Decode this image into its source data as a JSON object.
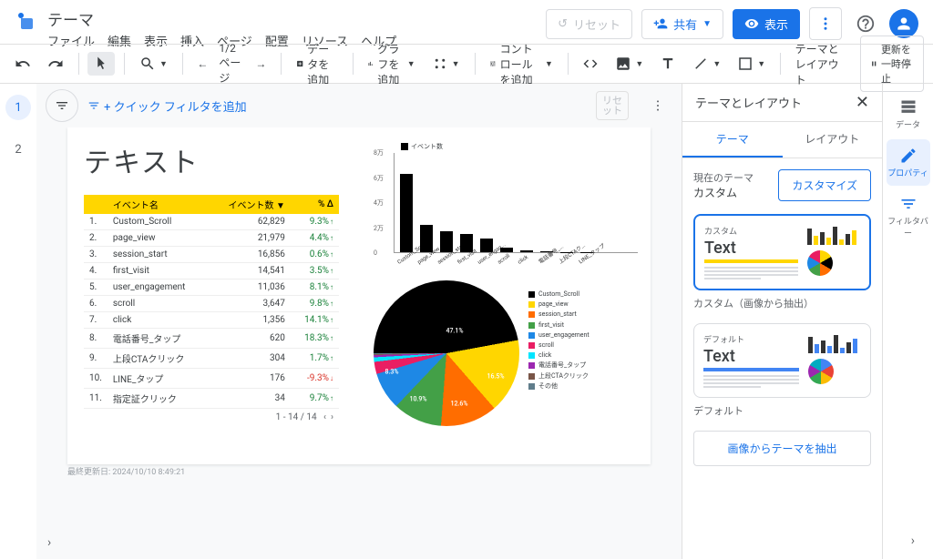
{
  "doc_title": "テーマ",
  "menu": [
    "ファイル",
    "編集",
    "表示",
    "挿入",
    "ページ",
    "配置",
    "リソース",
    "ヘルプ"
  ],
  "actions": {
    "reset": "リセット",
    "share": "共有",
    "view": "表示"
  },
  "tool_texts": {
    "page": "1/2 ページ",
    "add_data": "データを追加",
    "add_chart": "グラフを追加",
    "add_control": "コントロールを追加",
    "theme_layout": "テーマとレイアウト",
    "pause": "更新を一時停止"
  },
  "filter": {
    "quick": "+ クイック フィルタを追加",
    "reset": "リセット"
  },
  "report": {
    "title": "テキスト",
    "table_headers": [
      "イベント名",
      "イベント数",
      "% Δ"
    ],
    "rows": [
      {
        "n": 1,
        "name": "Custom_Scroll",
        "count": "62,829",
        "delta": "9.3%",
        "up": true
      },
      {
        "n": 2,
        "name": "page_view",
        "count": "21,979",
        "delta": "4.4%",
        "up": true
      },
      {
        "n": 3,
        "name": "session_start",
        "count": "16,856",
        "delta": "0.6%",
        "up": true
      },
      {
        "n": 4,
        "name": "first_visit",
        "count": "14,541",
        "delta": "3.5%",
        "up": true
      },
      {
        "n": 5,
        "name": "user_engagement",
        "count": "11,036",
        "delta": "8.1%",
        "up": true
      },
      {
        "n": 6,
        "name": "scroll",
        "count": "3,647",
        "delta": "9.8%",
        "up": true
      },
      {
        "n": 7,
        "name": "click",
        "count": "1,356",
        "delta": "14.1%",
        "up": true
      },
      {
        "n": 8,
        "name": "電話番号_タップ",
        "count": "620",
        "delta": "18.3%",
        "up": true
      },
      {
        "n": 9,
        "name": "上段CTAクリック",
        "count": "304",
        "delta": "1.7%",
        "up": true
      },
      {
        "n": 10,
        "name": "LINE_タップ",
        "count": "176",
        "delta": "-9.3%",
        "up": false
      },
      {
        "n": 11,
        "name": "指定証クリック",
        "count": "34",
        "delta": "9.7%",
        "up": true
      }
    ],
    "pager": "1 - 14 / 14",
    "timestamp": "最終更新日: 2024/10/10 8:49:21"
  },
  "chart_data": {
    "bar": {
      "type": "bar",
      "legend": "イベント数",
      "ylim": [
        0,
        80000
      ],
      "yticks": [
        "0",
        "2万",
        "4万",
        "6万",
        "8万"
      ],
      "categories": [
        "Custom_Sc...",
        "page_view",
        "session_sta...",
        "first_visit",
        "user_engag...",
        "scroll",
        "click",
        "電話番号_...",
        "上段CTAク...",
        "LINE_タップ"
      ],
      "values": [
        62829,
        21979,
        16856,
        14541,
        11036,
        3647,
        1356,
        620,
        304,
        176
      ]
    },
    "pie": {
      "type": "pie",
      "labels": [
        "Custom_Scroll",
        "page_view",
        "session_start",
        "first_visit",
        "user_engagement",
        "scroll",
        "click",
        "電話番号_タップ",
        "上段CTAクリック",
        "その他"
      ],
      "values": [
        47.1,
        16.5,
        12.6,
        10.9,
        8.3,
        2.7,
        1.0,
        0.5,
        0.2,
        0.2
      ],
      "shown_labels": [
        "47.1%",
        "16.5%",
        "12.6%",
        "10.9%",
        "8.3%"
      ],
      "colors": [
        "#000000",
        "#ffd600",
        "#ff6d00",
        "#43a047",
        "#1e88e5",
        "#e91e63",
        "#00e5ff",
        "#9c27b0",
        "#795548",
        "#607d8b"
      ]
    }
  },
  "panel": {
    "title": "テーマとレイアウト",
    "tabs": [
      "テーマ",
      "レイアウト"
    ],
    "current_label": "現在のテーマ",
    "current_name": "カスタム",
    "customize": "カスタマイズ",
    "themes": [
      {
        "label": "カスタム",
        "full": "カスタム（画像から抽出）",
        "accent": "#ffd600",
        "pie": [
          "#ffd600",
          "#000",
          "#ff6d00",
          "#43a047",
          "#1e88e5",
          "#e91e63"
        ]
      },
      {
        "label": "デフォルト",
        "full": "デフォルト",
        "accent": "#4285f4",
        "pie": [
          "#4285f4",
          "#ea4335",
          "#fbbc04",
          "#34a853",
          "#9c27b0",
          "#00acc1"
        ]
      }
    ],
    "extract": "画像からテーマを抽出"
  },
  "side": [
    {
      "id": "data",
      "label": "データ"
    },
    {
      "id": "props",
      "label": "プロパティ"
    },
    {
      "id": "filter",
      "label": "フィルタバー"
    }
  ]
}
